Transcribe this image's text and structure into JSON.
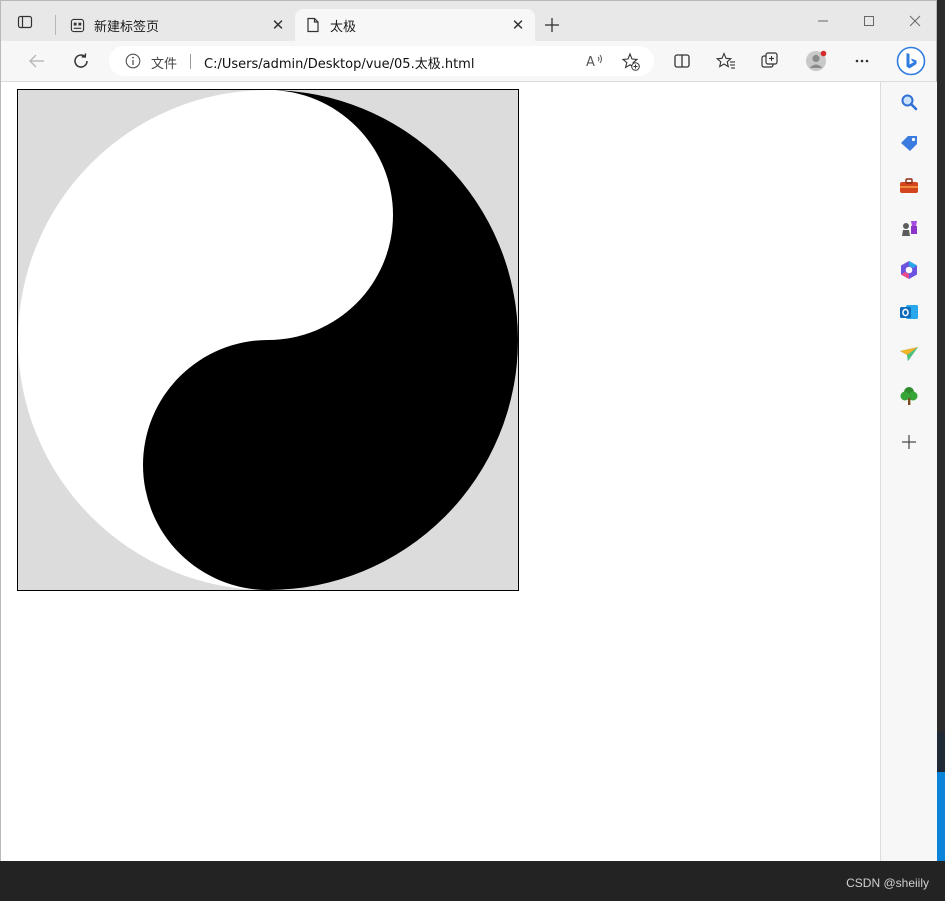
{
  "tabs": [
    {
      "title": "新建标签页",
      "active": false
    },
    {
      "title": "太极",
      "active": true
    }
  ],
  "address_bar": {
    "protocol_label": "文件",
    "url": "C:/Users/admin/Desktop/vue/05.太极.html",
    "read_aloud_label": "A⁾"
  },
  "icons": {
    "tab_actions": "tab-actions-icon",
    "new_tab": "plus-icon",
    "back": "back-arrow-icon",
    "refresh": "refresh-icon",
    "info": "info-icon",
    "favorite_add": "star-plus-icon",
    "split_screen": "split-screen-icon",
    "favorites": "favorites-icon",
    "collections": "collections-icon",
    "profile": "profile-avatar-icon",
    "more": "more-icon",
    "copilot": "bing-copilot-icon"
  },
  "sidebar": [
    "search-icon",
    "shopping-tag-icon",
    "tools-briefcase-icon",
    "games-icon",
    "microsoft365-icon",
    "outlook-icon",
    "send-icon",
    "tree-icon",
    "add-icon"
  ],
  "page": {
    "yin_yang": {
      "light_color": "#ffffff",
      "dark_color": "#000000",
      "background": "#dcdcdc"
    }
  },
  "watermark": "CSDN @sheiily"
}
